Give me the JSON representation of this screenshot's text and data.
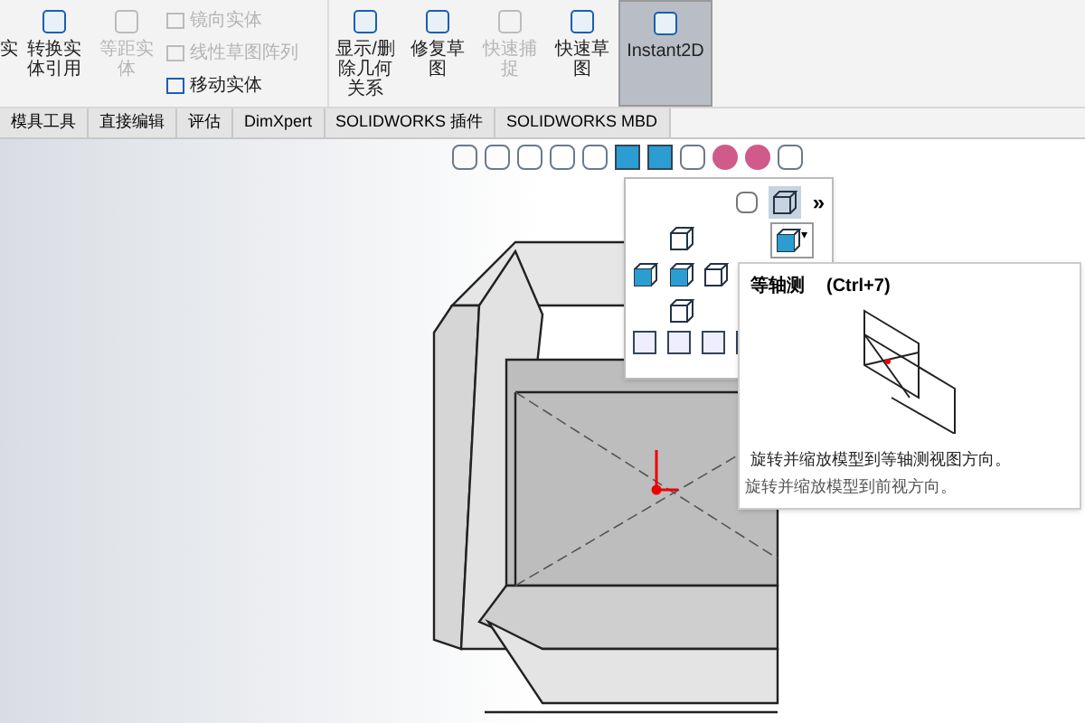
{
  "ribbon": {
    "items": [
      {
        "label": "实",
        "kind": "cut"
      },
      {
        "label": "转换实体引用",
        "kind": "big",
        "disabled": false,
        "selected": false
      },
      {
        "label": "等距实体",
        "kind": "big",
        "disabled": true,
        "selected": false
      },
      {
        "kind": "stack",
        "lines": [
          {
            "label": "镜向实体",
            "disabled": true
          },
          {
            "label": "线性草图阵列",
            "disabled": true
          },
          {
            "label": "移动实体",
            "disabled": false
          }
        ]
      },
      {
        "label": "显示/删除几何关系",
        "kind": "big",
        "disabled": false,
        "selected": false
      },
      {
        "label": "修复草图",
        "kind": "big",
        "disabled": false,
        "selected": false
      },
      {
        "label": "快速捕捉",
        "kind": "big",
        "disabled": true,
        "selected": false
      },
      {
        "label": "快速草图",
        "kind": "big",
        "disabled": false,
        "selected": false
      },
      {
        "label": "Instant2D",
        "kind": "big",
        "disabled": false,
        "selected": true
      }
    ]
  },
  "tabs": [
    {
      "label": "模具工具",
      "selected": false
    },
    {
      "label": "直接编辑",
      "selected": false
    },
    {
      "label": "评估",
      "selected": false
    },
    {
      "label": "DimXpert",
      "selected": false
    },
    {
      "label": "SOLIDWORKS 插件",
      "selected": false
    },
    {
      "label": "SOLIDWORKS MBD",
      "selected": false
    }
  ],
  "view_popup": {
    "more": "»",
    "caret": "▾"
  },
  "tooltip": {
    "title": "等轴测",
    "shortcut": "(Ctrl+7)",
    "description": "旋转并缩放模型到等轴测视图方向。"
  },
  "background_tooltip": {
    "description": "旋转并缩放模型到前视方向。"
  }
}
